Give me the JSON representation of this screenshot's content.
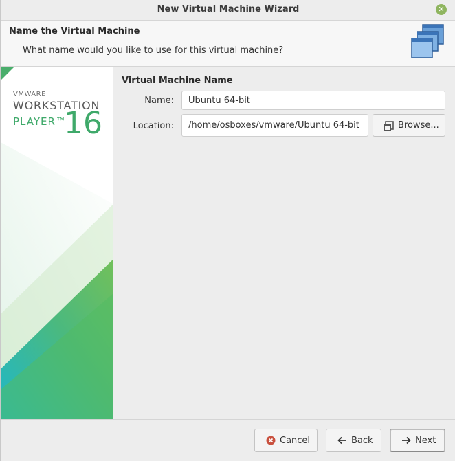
{
  "window": {
    "title": "New Virtual Machine Wizard",
    "close_icon": "close-icon"
  },
  "header": {
    "title": "Name the Virtual Machine",
    "subtitle": "What name would you like to use for this virtual machine?",
    "icon": "stacked-windows-icon"
  },
  "brand": {
    "vmware": "VMWARE",
    "product": "WORKSTATION",
    "edition": "PLAYER™",
    "version": "16",
    "accent_color": "#3fa96a"
  },
  "form": {
    "section_title": "Virtual Machine Name",
    "name_label": "Name:",
    "name_value": "Ubuntu 64-bit",
    "location_label": "Location:",
    "location_value": "/home/osboxes/vmware/Ubuntu 64-bit",
    "browse_label": "Browse..."
  },
  "footer": {
    "cancel_label": "Cancel",
    "back_label": "Back",
    "next_label": "Next"
  }
}
